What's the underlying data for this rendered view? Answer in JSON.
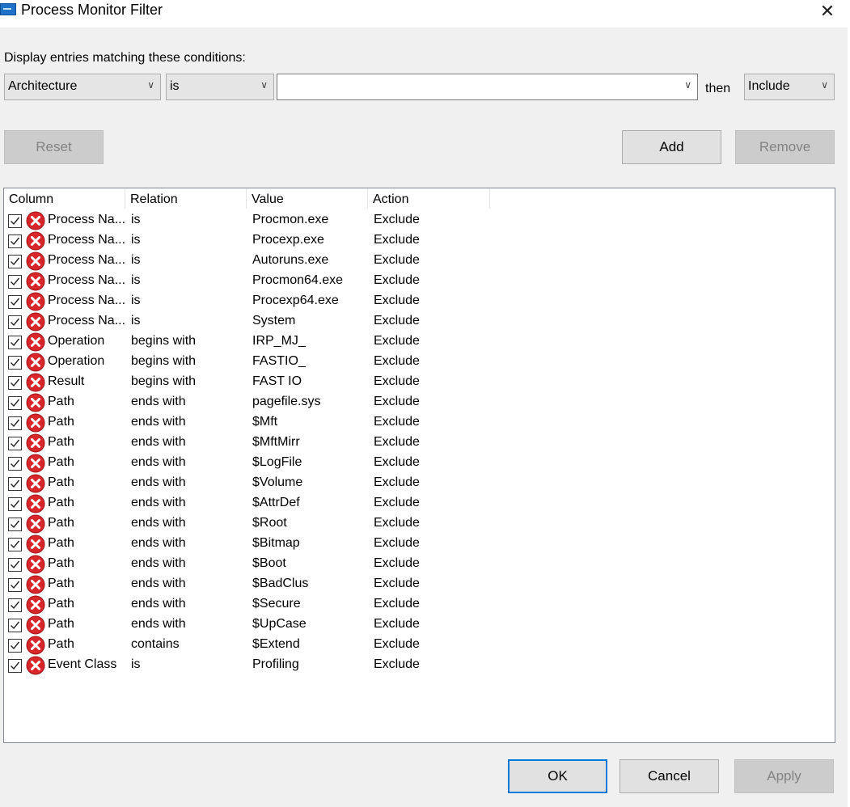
{
  "window": {
    "title": "Process Monitor Filter",
    "close_glyph": "✕"
  },
  "condition": {
    "label": "Display entries matching these conditions:",
    "column_value": "Architecture",
    "relation_value": "is",
    "value_text": "",
    "then_label": "then",
    "action_value": "Include"
  },
  "buttons": {
    "reset": "Reset",
    "add": "Add",
    "remove": "Remove",
    "ok": "OK",
    "cancel": "Cancel",
    "apply": "Apply"
  },
  "colors": {
    "accent": "#0078d7",
    "exclude_icon": "#d9262b",
    "window_bg": "#f0f0f0"
  },
  "icons": {
    "app": "process-monitor-icon",
    "close": "close-icon",
    "row": "exclude-x-icon",
    "check": "checkmark-icon",
    "dropdown": "chevron-down-icon"
  },
  "table": {
    "headers": [
      "Column",
      "Relation",
      "Value",
      "Action"
    ],
    "rows": [
      {
        "checked": true,
        "column": "Process Na...",
        "relation": "is",
        "value": "Procmon.exe",
        "action": "Exclude"
      },
      {
        "checked": true,
        "column": "Process Na...",
        "relation": "is",
        "value": "Procexp.exe",
        "action": "Exclude"
      },
      {
        "checked": true,
        "column": "Process Na...",
        "relation": "is",
        "value": "Autoruns.exe",
        "action": "Exclude"
      },
      {
        "checked": true,
        "column": "Process Na...",
        "relation": "is",
        "value": "Procmon64.exe",
        "action": "Exclude"
      },
      {
        "checked": true,
        "column": "Process Na...",
        "relation": "is",
        "value": "Procexp64.exe",
        "action": "Exclude"
      },
      {
        "checked": true,
        "column": "Process Na...",
        "relation": "is",
        "value": "System",
        "action": "Exclude"
      },
      {
        "checked": true,
        "column": "Operation",
        "relation": "begins with",
        "value": "IRP_MJ_",
        "action": "Exclude"
      },
      {
        "checked": true,
        "column": "Operation",
        "relation": "begins with",
        "value": "FASTIO_",
        "action": "Exclude"
      },
      {
        "checked": true,
        "column": "Result",
        "relation": "begins with",
        "value": "FAST IO",
        "action": "Exclude"
      },
      {
        "checked": true,
        "column": "Path",
        "relation": "ends with",
        "value": "pagefile.sys",
        "action": "Exclude"
      },
      {
        "checked": true,
        "column": "Path",
        "relation": "ends with",
        "value": "$Mft",
        "action": "Exclude"
      },
      {
        "checked": true,
        "column": "Path",
        "relation": "ends with",
        "value": "$MftMirr",
        "action": "Exclude"
      },
      {
        "checked": true,
        "column": "Path",
        "relation": "ends with",
        "value": "$LogFile",
        "action": "Exclude"
      },
      {
        "checked": true,
        "column": "Path",
        "relation": "ends with",
        "value": "$Volume",
        "action": "Exclude"
      },
      {
        "checked": true,
        "column": "Path",
        "relation": "ends with",
        "value": "$AttrDef",
        "action": "Exclude"
      },
      {
        "checked": true,
        "column": "Path",
        "relation": "ends with",
        "value": "$Root",
        "action": "Exclude"
      },
      {
        "checked": true,
        "column": "Path",
        "relation": "ends with",
        "value": "$Bitmap",
        "action": "Exclude"
      },
      {
        "checked": true,
        "column": "Path",
        "relation": "ends with",
        "value": "$Boot",
        "action": "Exclude"
      },
      {
        "checked": true,
        "column": "Path",
        "relation": "ends with",
        "value": "$BadClus",
        "action": "Exclude"
      },
      {
        "checked": true,
        "column": "Path",
        "relation": "ends with",
        "value": "$Secure",
        "action": "Exclude"
      },
      {
        "checked": true,
        "column": "Path",
        "relation": "ends with",
        "value": "$UpCase",
        "action": "Exclude"
      },
      {
        "checked": true,
        "column": "Path",
        "relation": "contains",
        "value": "$Extend",
        "action": "Exclude"
      },
      {
        "checked": true,
        "column": "Event Class",
        "relation": "is",
        "value": "Profiling",
        "action": "Exclude"
      }
    ]
  }
}
